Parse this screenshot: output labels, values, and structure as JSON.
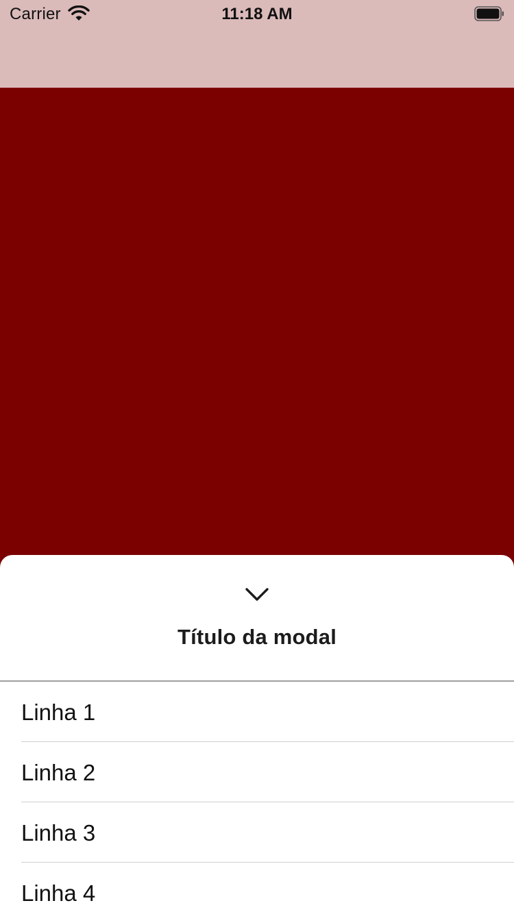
{
  "status_bar": {
    "carrier": "Carrier",
    "time": "11:18 AM",
    "icons": [
      "wifi-icon",
      "battery-icon"
    ]
  },
  "colors": {
    "nav_background": "#DBBABA",
    "content_background": "#7B0000",
    "sheet_background": "#FFFFFF",
    "divider": "#9E9E9E"
  },
  "modal": {
    "dismiss_icon": "chevron-down-icon",
    "title": "Título da modal",
    "rows": [
      {
        "label": "Linha 1"
      },
      {
        "label": "Linha 2"
      },
      {
        "label": "Linha 3"
      },
      {
        "label": "Linha 4"
      }
    ]
  }
}
